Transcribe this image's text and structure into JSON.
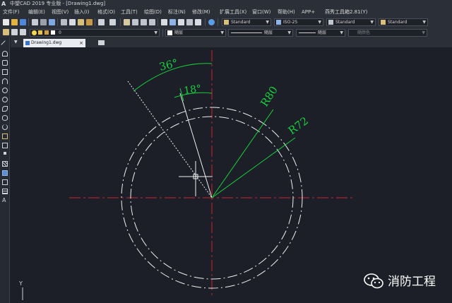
{
  "window": {
    "title": "中望CAD 2019 专业版 - [Drawing1.dwg]",
    "app_icon": "A"
  },
  "menu": [
    "文件(F)",
    "编辑(E)",
    "视图(V)",
    "插入(I)",
    "格式(O)",
    "工具(T)",
    "绘图(D)",
    "标注(N)",
    "修改(M)",
    "扩展工具(X)",
    "窗口(W)",
    "帮助(H)",
    "APP+",
    "燕秀工具箱2.81(Y)"
  ],
  "toolbar": {
    "text_style": "Standard",
    "dim_style": "ISO-25",
    "table_style": "Standard",
    "multileader_style": "Standard",
    "layer": "0",
    "color": "随层",
    "linetype": "随层",
    "lineweight": "随层",
    "plot_style": "随颜色"
  },
  "tabs": {
    "active": "Drawing1.dwg",
    "close_glyph": "×"
  },
  "drawing": {
    "dimensions": [
      "36°",
      "18°",
      "R80",
      "R72"
    ],
    "ucs_label": "Y"
  },
  "watermark": {
    "text": "消防工程"
  },
  "colors": {
    "background": "#1c1f27",
    "chrome": "#2b2f38",
    "centerline": "#c8242a",
    "dimension": "#17d13c",
    "geometry": "#f0f0f0"
  }
}
